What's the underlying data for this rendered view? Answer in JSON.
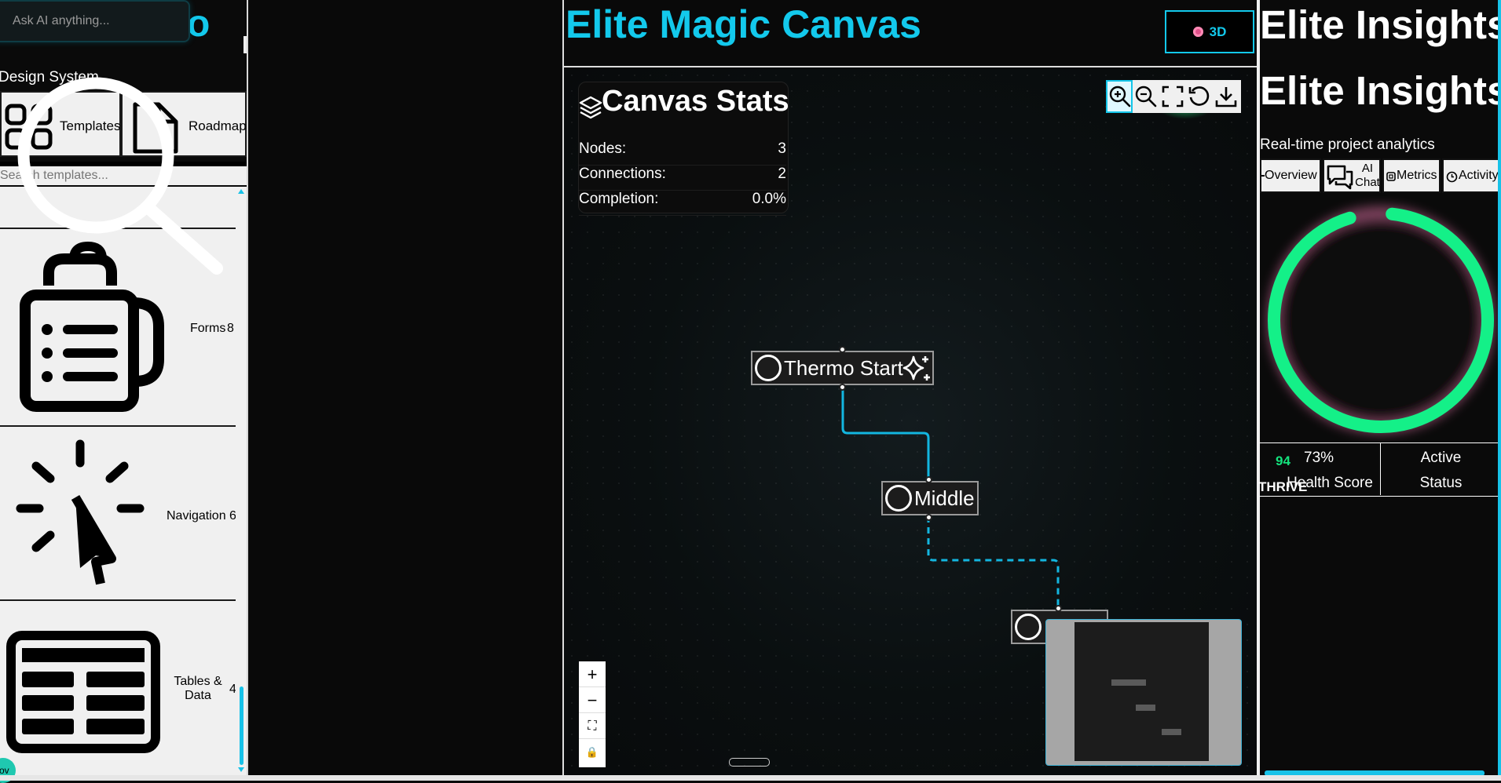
{
  "left_panel": {
    "ai_placeholder": "Ask AI anything...",
    "brand_glyph": "o",
    "section_title": "Design System",
    "template_buttons": [
      {
        "label": "Templates",
        "icon": "grid-icon"
      },
      {
        "label": "Roadmap",
        "icon": "document-icon"
      }
    ],
    "search_placeholder": "Search templates...",
    "categories": [
      {
        "label": "Forms",
        "count": "8",
        "icon": "clipboard-list-icon"
      },
      {
        "label": "Navigation",
        "count": "6",
        "icon": "cursor-click-icon"
      },
      {
        "label": "Tables & Data",
        "count": "4",
        "icon": "table-icon"
      }
    ],
    "corner_badge": "lov"
  },
  "canvas": {
    "title": "Elite Magic Canvas",
    "btn_3d_label": "3D",
    "stats": {
      "title": "Canvas Stats",
      "rows": [
        {
          "label": "Nodes:",
          "value": "3"
        },
        {
          "label": "Connections:",
          "value": "2"
        },
        {
          "label": "Completion:",
          "value": "0.0%"
        }
      ]
    },
    "toolbar": [
      "zoom-in-icon",
      "zoom-out-icon",
      "fit-view-icon",
      "reset-icon",
      "download-icon"
    ],
    "zoom_controls": [
      "+",
      "−",
      "⛶",
      "🔒"
    ],
    "nodes": [
      {
        "label": "Thermo Start",
        "icon": "sparkle-icon"
      },
      {
        "label": "Middle"
      },
      {
        "label": ""
      }
    ]
  },
  "insights": {
    "title": "Elite Insights",
    "subtitle": "Real-time project analytics",
    "tabs": [
      {
        "label": "Overview",
        "icon": "dot-icon"
      },
      {
        "label": "AI Chat",
        "icon": "chat-icon"
      },
      {
        "label": "Metrics",
        "icon": "chip-icon"
      },
      {
        "label": "Activity",
        "icon": "clock-icon"
      }
    ],
    "health_value": "73%",
    "health_label": "Health Score",
    "status_value": "Active",
    "status_label": "Status",
    "score_badge": "94",
    "thrive_label": "THRIVE",
    "ring_color": "#14f088",
    "accent": "#13c9ec"
  }
}
